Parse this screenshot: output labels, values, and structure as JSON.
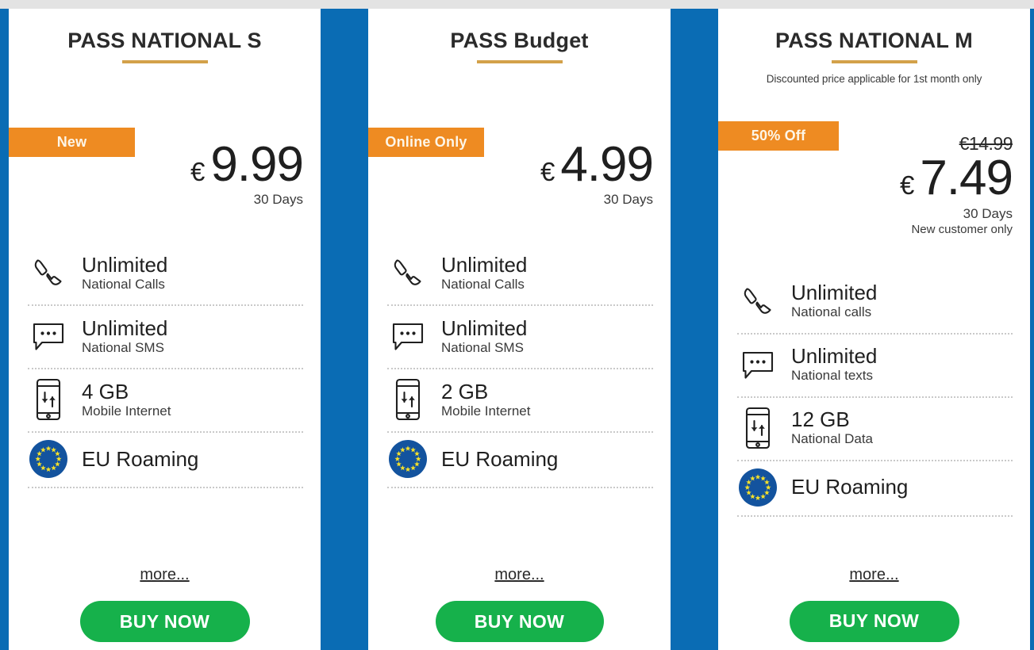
{
  "theme": {
    "page_background": "#0a6cb4",
    "top_strip": "#e3e3e3",
    "card_background": "#ffffff",
    "badge_orange": "#ee8b22",
    "title_rule_gold": "#d3a14a",
    "buy_green": "#16b14b",
    "text_dark": "#1f1f1f"
  },
  "cards": [
    {
      "title": "PASS NATIONAL S",
      "subtitle": "",
      "badge": "New",
      "old_price": "",
      "currency": "€",
      "price": "9.99",
      "period": "30 Days",
      "note": "",
      "features": [
        {
          "icon": "phone-handset-icon",
          "main": "Unlimited",
          "sub": "National Calls"
        },
        {
          "icon": "sms-bubble-icon",
          "main": "Unlimited",
          "sub": "National SMS"
        },
        {
          "icon": "mobile-data-icon",
          "main": "4 GB",
          "sub": "Mobile Internet"
        },
        {
          "icon": "eu-flag-icon",
          "main": "EU Roaming",
          "sub": ""
        }
      ],
      "more_label": "more...",
      "buy_label": "BUY NOW"
    },
    {
      "title": "PASS Budget",
      "subtitle": "",
      "badge": "Online Only",
      "old_price": "",
      "currency": "€",
      "price": "4.99",
      "period": "30 Days",
      "note": "",
      "features": [
        {
          "icon": "phone-handset-icon",
          "main": "Unlimited",
          "sub": "National Calls"
        },
        {
          "icon": "sms-bubble-icon",
          "main": "Unlimited",
          "sub": "National SMS"
        },
        {
          "icon": "mobile-data-icon",
          "main": "2 GB",
          "sub": "Mobile Internet"
        },
        {
          "icon": "eu-flag-icon",
          "main": "EU Roaming",
          "sub": ""
        }
      ],
      "more_label": "more...",
      "buy_label": "BUY NOW"
    },
    {
      "title": "PASS NATIONAL M",
      "subtitle": "Discounted price applicable for 1st month only",
      "badge": "50% Off",
      "old_price": "€14.99",
      "currency": "€",
      "price": "7.49",
      "period": "30 Days",
      "note": "New customer only",
      "features": [
        {
          "icon": "phone-handset-icon",
          "main": "Unlimited",
          "sub": "National calls"
        },
        {
          "icon": "sms-bubble-icon",
          "main": "Unlimited",
          "sub": "National texts"
        },
        {
          "icon": "mobile-data-icon",
          "main": "12 GB",
          "sub": "National Data"
        },
        {
          "icon": "eu-flag-icon",
          "main": "EU Roaming",
          "sub": ""
        }
      ],
      "more_label": "more...",
      "buy_label": "BUY NOW"
    }
  ]
}
